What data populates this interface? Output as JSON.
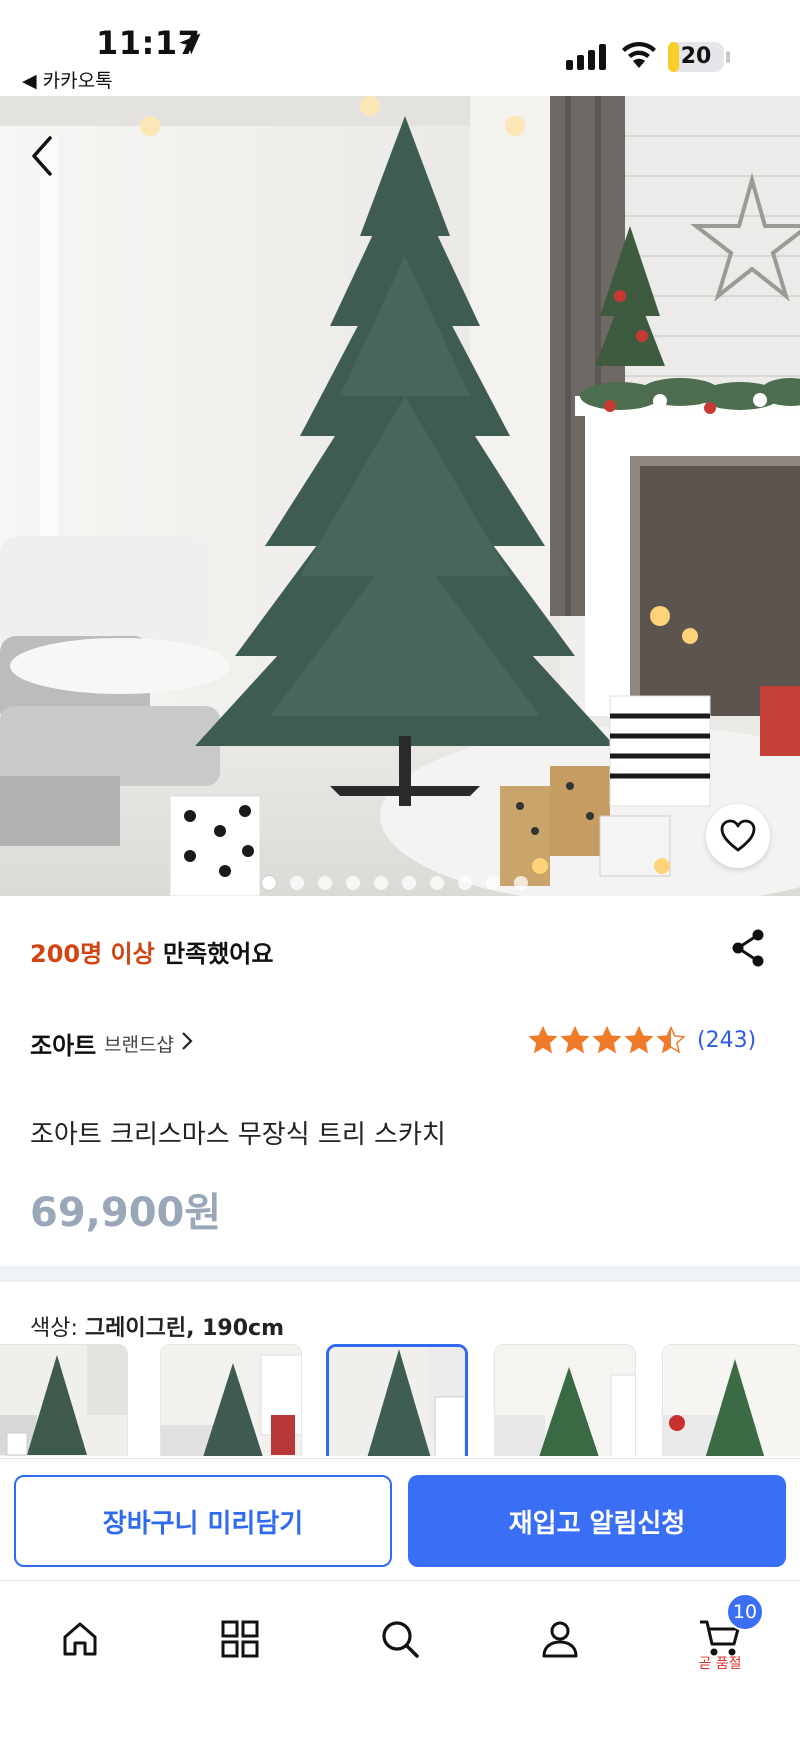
{
  "status_bar": {
    "time": "11:17",
    "back_app": "◀ 카카오톡",
    "battery": "20",
    "battery_level": 0.2
  },
  "product": {
    "satisfied_highlight": "200명 이상",
    "satisfied_text": " 만족했어요",
    "brand": "조아트",
    "brand_shop": "브랜드샵",
    "rating": 4.5,
    "review_count": "(243)",
    "title": "조아트 크리스마스 무장식 트리 스카치",
    "price": "69,900원"
  },
  "gallery": {
    "image_count": 10,
    "active_index": 0
  },
  "option": {
    "label": "색상: ",
    "value": "그레이그린, 190cm",
    "selected_index": 2
  },
  "actions": {
    "cart_label": "장바구니 미리담기",
    "notify_label": "재입고 알림신청"
  },
  "tab_bar": {
    "cart_badge": "10",
    "cart_sub": "곧 품절"
  },
  "colors": {
    "accent": "#3a6ff5",
    "highlight": "#d2440f",
    "star": "#f07a2c",
    "price": "#9aa7b8"
  },
  "icons": [
    "location-arrow-icon",
    "signal-icon",
    "wifi-icon",
    "battery-icon",
    "back-icon",
    "heart-icon",
    "share-icon",
    "star-icon",
    "chevron-right-icon",
    "home-icon",
    "category-icon",
    "search-icon",
    "profile-icon",
    "cart-icon"
  ]
}
